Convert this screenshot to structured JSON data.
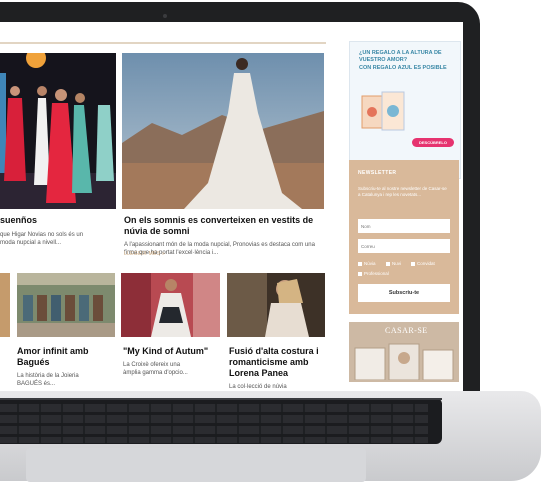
{
  "articles_top": [
    {
      "title": "suenños",
      "excerpt": "que Higar Novias no sols és un\nmoda nupcial a nivell..."
    },
    {
      "title": "On els somnis es converteixen en vestits de núvia de somni",
      "excerpt": "A l'apassionant món de la moda nupcial, Pronovias es destaca com una firma que ha portat l'excel·lència i...",
      "more": "LLEGEIX MÉS »"
    }
  ],
  "articles_bottom": [
    {
      "title": "Amor infinit amb Bagués",
      "excerpt": "La història de la Joieria\nBAGUÉS és..."
    },
    {
      "title": "\"My Kind of Autum\"",
      "excerpt": "La Croixè ofereix una\nàmplia gamma d'opcio..."
    },
    {
      "title": "Fusió d'alta costura i romanticisme amb Lorena Panea",
      "excerpt": "La col·lecció de núvia"
    }
  ],
  "ad": {
    "headline": "¿UN REGALO A LA ALTURA DE VUESTRO AMOR?",
    "sub": "CON REGALO AZUL ES POSIBLE",
    "button": "DESCÚBRELO",
    "brand1": "Regalo Azul",
    "brand2": "unicef"
  },
  "newsletter": {
    "heading": "NEWSLETTER",
    "text": "Subscriu-te al nostre newsletter de Casar-se a Catalunya i rep les novetats...",
    "name_placeholder": "Nom",
    "email_placeholder": "Correu",
    "options": [
      "Núvia",
      "Nuvi",
      "Convidat",
      "Professional"
    ],
    "subscribe": "Subscriu-te"
  },
  "magazine": {
    "title": "CASAR-SE"
  },
  "colors": {
    "accent": "#c9a57a",
    "newsletter_bg": "#d9b99a",
    "ad_pink": "#e6336f",
    "ad_blue": "#3a88a6"
  }
}
